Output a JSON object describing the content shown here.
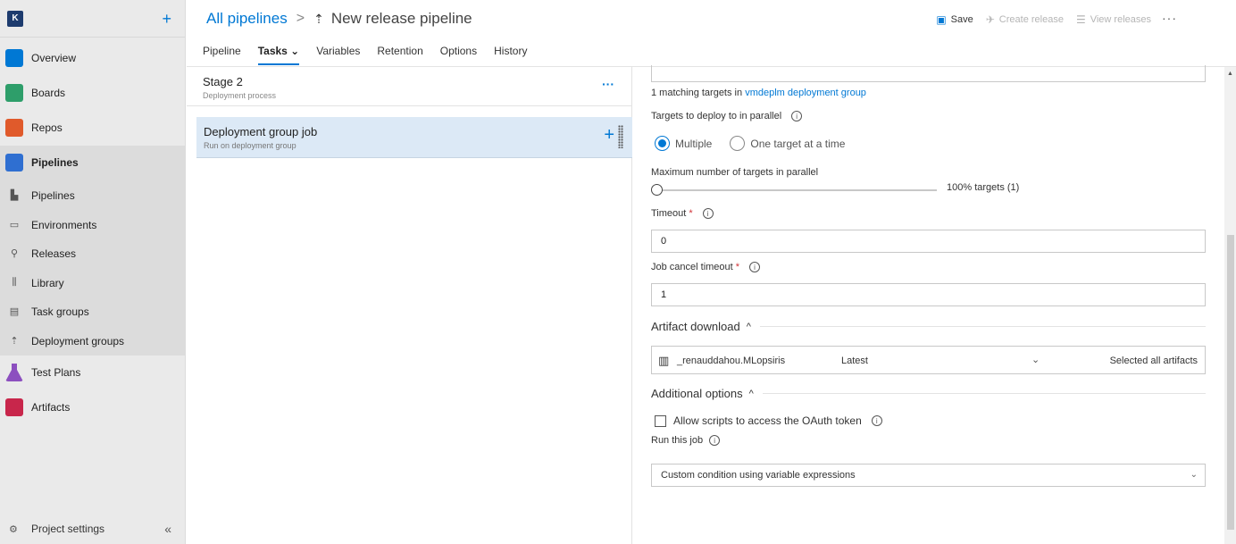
{
  "sidebar": {
    "org_initial": "K",
    "add_icon": "plus-icon",
    "items": [
      {
        "label": "Overview",
        "icon": "overview-icon",
        "color": "#0078d4"
      },
      {
        "label": "Boards",
        "icon": "boards-icon",
        "color": "#2e9e6a"
      },
      {
        "label": "Repos",
        "icon": "repos-icon",
        "color": "#e05a2b"
      },
      {
        "label": "Pipelines",
        "icon": "pipelines-icon",
        "color": "#2f6fd1"
      },
      {
        "label": "Pipelines",
        "icon": "pipelines-sub-icon"
      },
      {
        "label": "Environments",
        "icon": "environments-icon"
      },
      {
        "label": "Releases",
        "icon": "releases-icon"
      },
      {
        "label": "Library",
        "icon": "library-icon"
      },
      {
        "label": "Task groups",
        "icon": "task-groups-icon"
      },
      {
        "label": "Deployment groups",
        "icon": "deployment-groups-icon"
      },
      {
        "label": "Test Plans",
        "icon": "test-plans-icon",
        "color": "#8c4fbf"
      },
      {
        "label": "Artifacts",
        "icon": "artifacts-icon",
        "color": "#c8264b"
      }
    ],
    "settings_label": "Project settings",
    "collapse_glyph": "«"
  },
  "header": {
    "breadcrumb_root": "All pipelines",
    "breadcrumb_sep": ">",
    "pipeline_icon_glyph": "⇡",
    "pipeline_name": "New release pipeline",
    "save_label": "Save",
    "create_release_label": "Create release",
    "view_releases_label": "View releases",
    "more_glyph": "···"
  },
  "tabs": [
    {
      "label": "Pipeline"
    },
    {
      "label": "Tasks ⌄"
    },
    {
      "label": "Variables"
    },
    {
      "label": "Retention"
    },
    {
      "label": "Options"
    },
    {
      "label": "History"
    }
  ],
  "stage": {
    "title": "Stage 2",
    "subtitle": "Deployment process",
    "more_glyph": "···"
  },
  "job": {
    "title": "Deployment group job",
    "subtitle": "Run on deployment group",
    "add_glyph": "+"
  },
  "form": {
    "matching_prefix": "1 matching targets in",
    "matching_link": "vmdeplm deployment group",
    "parallel_label": "Targets to deploy to in parallel",
    "radio_multiple": "Multiple",
    "radio_one": "One target at a time",
    "max_label": "Maximum number of targets in parallel",
    "slider_value_text": "100% targets (1)",
    "slider_level": 0,
    "timeout_label": "Timeout",
    "timeout_value": "0",
    "cancel_label": "Job cancel timeout",
    "cancel_value": "1",
    "required_mark": "*",
    "info_glyph": "i",
    "artifact_section": "Artifact download",
    "artifact_name": "_renauddahou.MLopsiris",
    "artifact_version": "Latest",
    "artifact_selection": "Selected all artifacts",
    "additional_section": "Additional options",
    "oauth_label": "Allow scripts to access the OAuth token",
    "run_label": "Run this job",
    "run_value": "Custom condition using variable expressions",
    "chevron_up": "^",
    "chevron_down": "⌄"
  }
}
